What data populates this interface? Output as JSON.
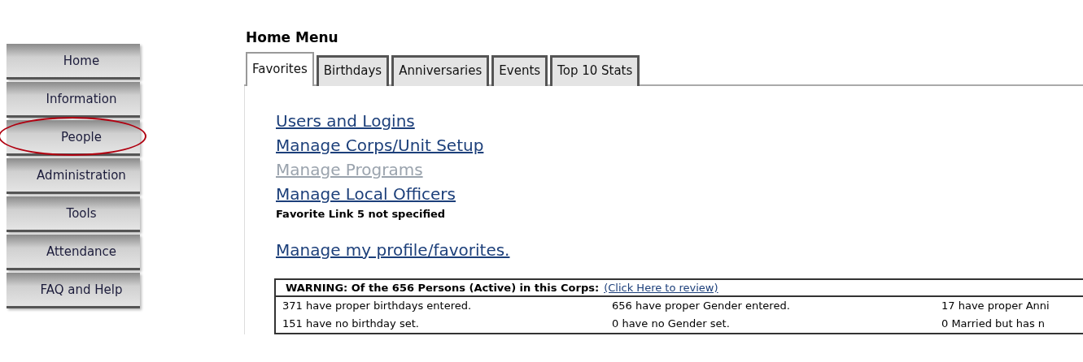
{
  "sidebar": {
    "items": [
      {
        "label": "Home",
        "circled": false
      },
      {
        "label": "Information",
        "circled": false
      },
      {
        "label": "People",
        "circled": true
      },
      {
        "label": "Administration",
        "circled": false
      },
      {
        "label": "Tools",
        "circled": false
      },
      {
        "label": "Attendance",
        "circled": false
      },
      {
        "label": "FAQ and Help",
        "circled": false
      }
    ]
  },
  "page_title": "Home Menu",
  "tabs": [
    {
      "label": "Favorites",
      "selected": true
    },
    {
      "label": "Birthdays",
      "selected": false
    },
    {
      "label": "Anniversaries",
      "selected": false
    },
    {
      "label": "Events",
      "selected": false
    },
    {
      "label": "Top 10 Stats",
      "selected": false
    }
  ],
  "favorites": [
    {
      "label": "Users and Logins",
      "disabled": false
    },
    {
      "label": "Manage Corps/Unit Setup",
      "disabled": false
    },
    {
      "label": "Manage Programs",
      "disabled": true
    },
    {
      "label": "Manage Local Officers",
      "disabled": false
    }
  ],
  "favorite_note": "Favorite Link 5 not specified",
  "profile_link": "Manage my profile/favorites.",
  "warning": {
    "text": "WARNING: Of the 656 Persons (Active) in this Corps:",
    "link": "(Click Here to review)",
    "rows": [
      [
        "371 have proper birthdays entered.",
        "656 have proper Gender entered.",
        "17 have proper Anni"
      ],
      [
        "151 have no birthday set.",
        "0 have no Gender set.",
        "0 Married but has n"
      ]
    ]
  }
}
